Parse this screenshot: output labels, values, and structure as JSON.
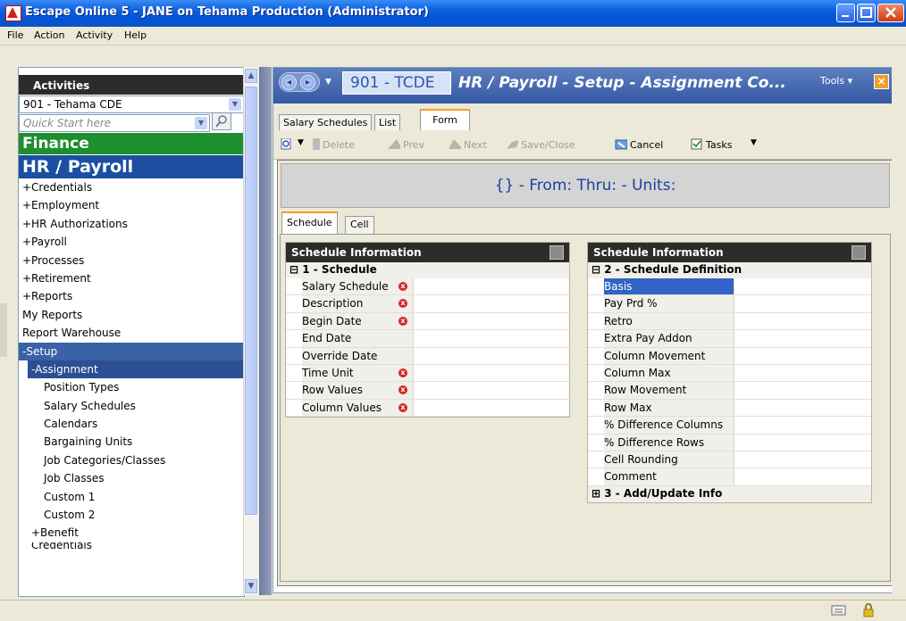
{
  "window": {
    "title": "Escape Online 5 - JANE on Tehama Production (Administrator)"
  },
  "menu": {
    "items": [
      "File",
      "Action",
      "Activity",
      "Help"
    ]
  },
  "sidebar": {
    "header": "Activities",
    "district": "901 - Tehama CDE",
    "quick_start_placeholder": "Quick Start here",
    "finance": "Finance",
    "hr_payroll": "HR / Payroll",
    "items": [
      "+Credentials",
      "+Employment",
      "+HR Authorizations",
      "+Payroll",
      "+Processes",
      "+Retirement",
      "+Reports",
      "My Reports",
      "Report Warehouse"
    ],
    "setup": "-Setup",
    "assignment": "-Assignment",
    "sub_items": [
      "Position Types",
      "Salary Schedules",
      "Calendars",
      "Bargaining Units",
      "Job Categories/Classes",
      "Job Classes",
      "Custom 1",
      "Custom 2"
    ],
    "benefit": "+Benefit",
    "partial": "Credentials"
  },
  "main": {
    "code": "901 - TCDE",
    "title": "HR / Payroll - Setup - Assignment Co...",
    "tools": "Tools ▾",
    "tabs": [
      "Salary Schedules",
      "List",
      "Form"
    ],
    "toolbar": {
      "delete": "Delete",
      "prev": "Prev",
      "next": "Next",
      "save_close": "Save/Close",
      "cancel": "Cancel",
      "tasks": "Tasks"
    },
    "banner": "{} - From: Thru: - Units:",
    "subtabs": [
      "Schedule",
      "Cell"
    ]
  },
  "left_section": {
    "header": "Schedule Information",
    "group": "1 - Schedule",
    "rows": [
      "Salary Schedule",
      "Description",
      "Begin Date",
      "End Date",
      "Override Date",
      "Time Unit",
      "Row Values",
      "Column Values"
    ],
    "required": [
      true,
      true,
      true,
      false,
      false,
      true,
      true,
      true
    ]
  },
  "right_section": {
    "header": "Schedule Information",
    "group": "2 - Schedule Definition",
    "rows": [
      "Basis",
      "Pay Prd %",
      "Retro",
      "Extra Pay Addon",
      "Column Movement",
      "Column Max",
      "Row Movement",
      "Row Max",
      "% Difference Columns",
      "% Difference Rows",
      "Cell Rounding",
      "Comment"
    ],
    "group3": "3 - Add/Update Info"
  },
  "colors": {
    "accent_orange": "#f3a01e",
    "finance_green": "#1e8f2f",
    "hr_blue": "#1c4fa1",
    "header_dark": "#2c2c2c",
    "required_red": "#d8232a"
  }
}
